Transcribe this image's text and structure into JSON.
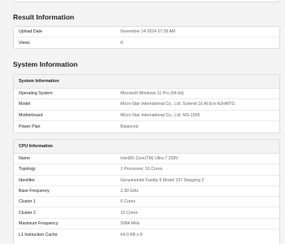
{
  "result_information": {
    "title": "Result Information",
    "rows": [
      {
        "key": "Upload Date",
        "value": "November 14 2024 07:39 AM"
      },
      {
        "key": "Views",
        "value": "8"
      }
    ]
  },
  "system_information": {
    "title": "System Information",
    "system_card": {
      "header": "System Information",
      "rows": [
        {
          "key": "Operating System",
          "value": "Microsoft Windows 11 Pro (64-bit)"
        },
        {
          "key": "Model",
          "value": "Micro-Star International Co., Ltd. Summit 16 AI Evo A2HMTG"
        },
        {
          "key": "Motherboard",
          "value": "Micro-Star International Co., Ltd. MS-1595"
        },
        {
          "key": "Power Plan",
          "value": "Balanced"
        }
      ]
    },
    "cpu_card": {
      "header": "CPU Information",
      "rows": [
        {
          "key": "Name",
          "value": "Intel(R) Core(TM) Ultra 7 258V"
        },
        {
          "key": "Topology",
          "value": "1 Processor, 16 Cores"
        },
        {
          "key": "Identifier",
          "value": "GenuineIntel Family 6 Model 197 Stepping 2"
        },
        {
          "key": "Base Frequency",
          "value": "2.30 GHz"
        },
        {
          "key": "Cluster 1",
          "value": "6 Cores"
        },
        {
          "key": "Cluster 2",
          "value": "10 Cores"
        },
        {
          "key": "Maximum Frequency",
          "value": "5084 MHz"
        },
        {
          "key": "L1 Instruction Cache",
          "value": "64.0 KB x 8"
        }
      ]
    }
  }
}
